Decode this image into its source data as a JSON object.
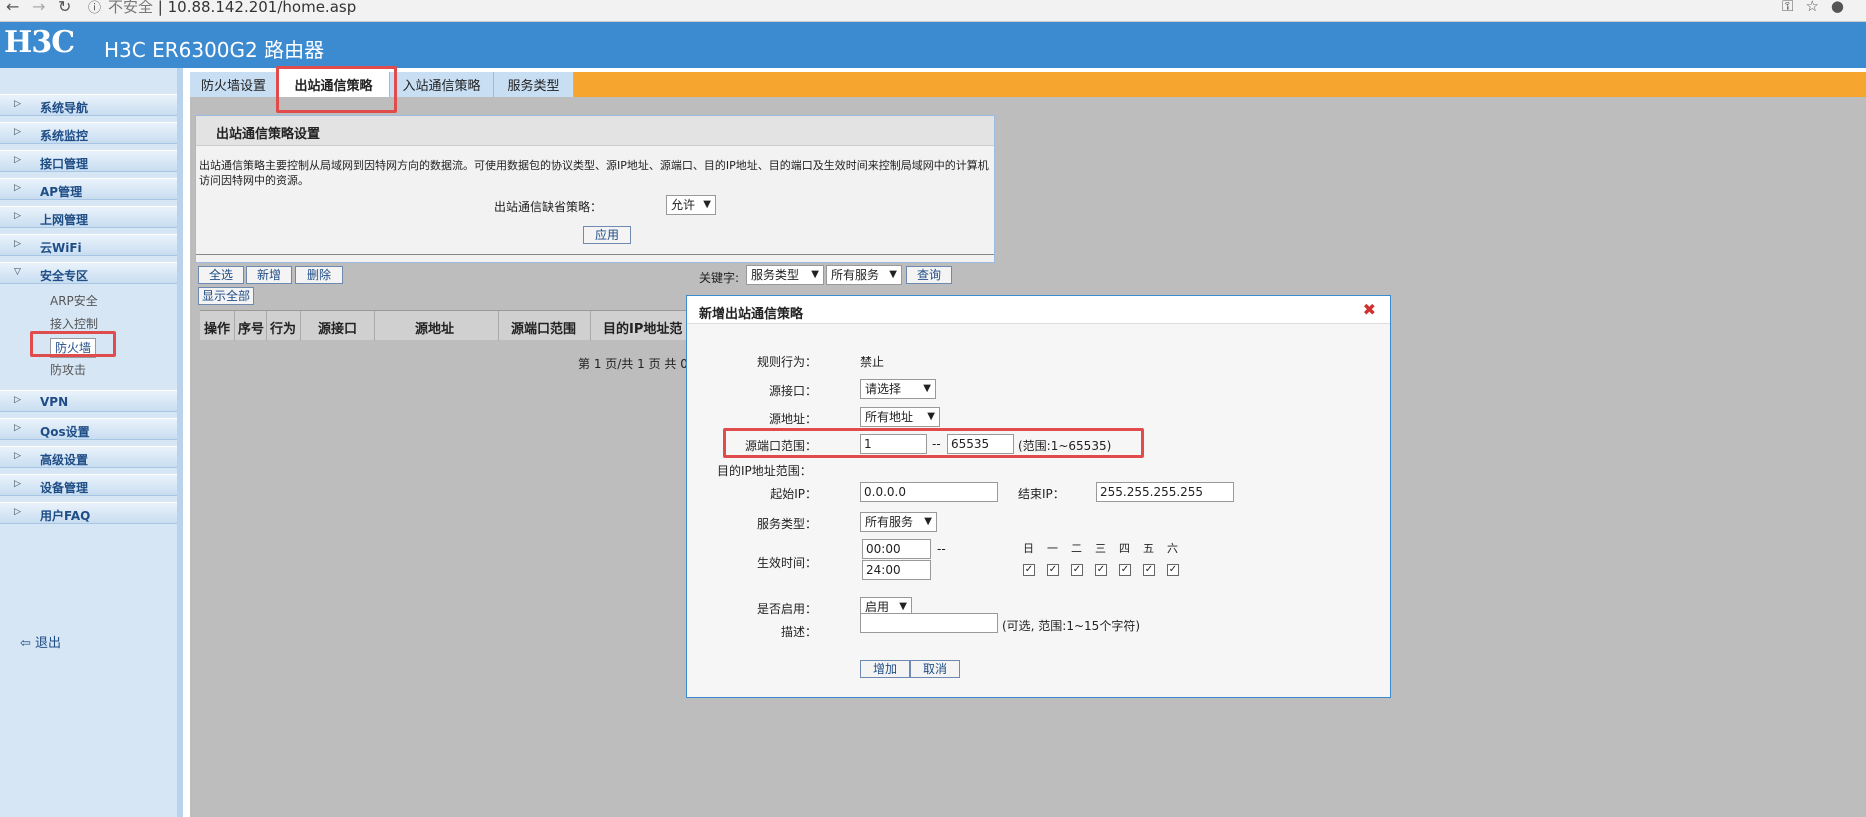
{
  "browser": {
    "security": "不安全",
    "url": "10.88.142.201/home.asp"
  },
  "header": {
    "logo": "H3C",
    "title": "H3C ER6300G2 路由器"
  },
  "sidebar": {
    "items": [
      {
        "label": "系统导航"
      },
      {
        "label": "系统监控"
      },
      {
        "label": "接口管理"
      },
      {
        "label": "AP管理"
      },
      {
        "label": "上网管理"
      },
      {
        "label": "云WiFi"
      },
      {
        "label": "安全专区"
      }
    ],
    "sub_items": [
      {
        "label": "ARP安全"
      },
      {
        "label": "接入控制"
      },
      {
        "label": "防火墙"
      },
      {
        "label": "防攻击"
      }
    ],
    "items_after": [
      {
        "label": "VPN"
      },
      {
        "label": "Qos设置"
      },
      {
        "label": "高级设置"
      },
      {
        "label": "设备管理"
      },
      {
        "label": "用户FAQ"
      }
    ],
    "logout": "退出"
  },
  "tabs": [
    {
      "label": "防火墙设置"
    },
    {
      "label": "出站通信策略"
    },
    {
      "label": "入站通信策略"
    },
    {
      "label": "服务类型"
    }
  ],
  "panel": {
    "title": "出站通信策略设置",
    "description": "出站通信策略主要控制从局域网到因特网方向的数据流。可使用数据包的协议类型、源IP地址、源端口、目的IP地址、目的端口及生效时间来控制局域网中的计算机访问因特网中的资源。",
    "default_label": "出站通信缺省策略：",
    "default_value": "允许",
    "apply": "应用"
  },
  "toolbar": {
    "select_all": "全选",
    "add": "新增",
    "delete": "删除",
    "show_all": "显示全部",
    "keyword_label": "关键字:",
    "kw_type": "服务类型",
    "kw_value": "所有服务",
    "query": "查询"
  },
  "table": {
    "headers": [
      "操作",
      "序号",
      "行为",
      "源接口",
      "源地址",
      "源端口范围",
      "目的IP地址范"
    ],
    "pager": "第 1 页/共 1 页 共 0"
  },
  "modal": {
    "title": "新增出站通信策略",
    "action_label": "规则行为：",
    "action_value": "禁止",
    "src_if_label": "源接口：",
    "src_if_value": "请选择",
    "src_addr_label": "源地址：",
    "src_addr_value": "所有地址",
    "src_port_label": "源端口范围：",
    "src_port_start": "1",
    "src_port_sep": "--",
    "src_port_end": "65535",
    "src_port_hint": "(范围:1~65535)",
    "dst_ip_label": "目的IP地址范围：",
    "start_ip_label": "起始IP：",
    "start_ip": "0.0.0.0",
    "end_ip_label": "结束IP：",
    "end_ip": "255.255.255.255",
    "service_label": "服务类型：",
    "service_value": "所有服务",
    "time_label": "生效时间：",
    "time_start": "00:00",
    "time_sep": "--",
    "time_end": "24:00",
    "days": [
      "日",
      "一",
      "二",
      "三",
      "四",
      "五",
      "六"
    ],
    "enable_label": "是否启用：",
    "enable_value": "启用",
    "desc_label": "描述：",
    "desc_value": "",
    "desc_hint": "(可选, 范围:1~15个字符)",
    "add_button": "增加",
    "cancel_button": "取消"
  }
}
